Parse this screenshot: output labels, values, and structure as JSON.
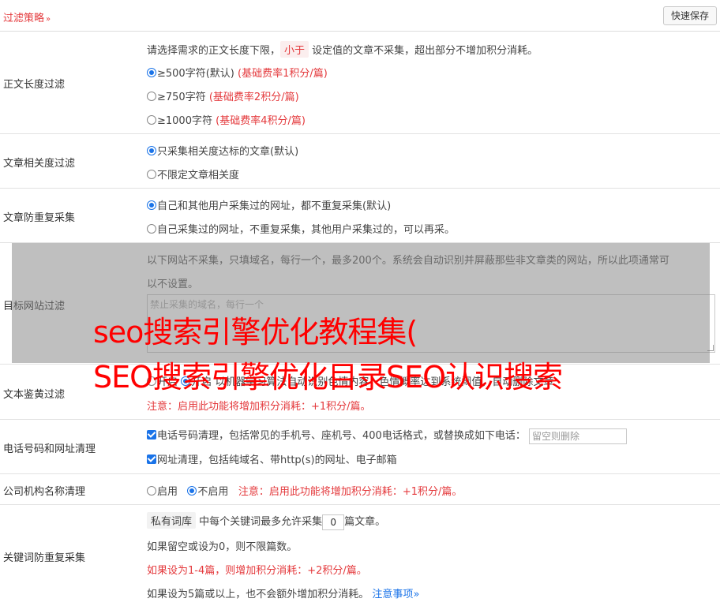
{
  "header": {
    "title": "过滤策略",
    "chevron": "»",
    "quick_save": "快速保存"
  },
  "length_filter": {
    "label": "正文长度过滤",
    "desc_pre": "请选择需求的正文长度下限，",
    "desc_pill": "小于",
    "desc_post": "设定值的文章不采集，超出部分不增加积分消耗。",
    "options": [
      {
        "label": "≥500字符(默认)",
        "note": "(基础费率1积分/篇)",
        "checked": true
      },
      {
        "label": "≥750字符",
        "note": "(基础费率2积分/篇)",
        "checked": false
      },
      {
        "label": "≥1000字符",
        "note": "(基础费率4积分/篇)",
        "checked": false
      }
    ]
  },
  "relevance": {
    "label": "文章相关度过滤",
    "options": [
      {
        "label": "只采集相关度达标的文章(默认)",
        "checked": true
      },
      {
        "label": "不限定文章相关度",
        "checked": false
      }
    ]
  },
  "dedupe": {
    "label": "文章防重复采集",
    "options": [
      {
        "label": "自己和其他用户采集过的网址，都不重复采集(默认)",
        "checked": true
      },
      {
        "label": "自己采集过的网址，不重复采集，其他用户采集过的，可以再采。",
        "checked": false
      }
    ]
  },
  "site_filter": {
    "label": "目标网站过滤",
    "desc_line1": "以下网站不采集，只填域名，每行一个，最多200个。系统会自动识别并屏蔽那些非文章类的网站，所以此项通常可",
    "desc_line2": "以不设置。",
    "placeholder": "禁止采集的域名，每行一个"
  },
  "porn_filter": {
    "label": "文本鉴黄过滤",
    "opt_off": "开启",
    "opt_on": "开启",
    "desc": "以机器学习算法自动识别色情内容，色情概率达到系统阈值，自动删除文章",
    "note": "注意：启用此功能将增加积分消耗：+1积分/篇。"
  },
  "phone_url": {
    "label": "电话号码和网址清理",
    "phone_label": "电话号码清理，包括常见的手机号、座机号、400电话格式，或替换成如下电话：",
    "phone_placeholder": "留空则删除",
    "url_label": "网址清理，包括纯域名、带http(s)的网址、电子邮箱"
  },
  "company": {
    "label": "公司机构名称清理",
    "opt_on": "启用",
    "opt_off": "不启用",
    "note": "注意：启用此功能将增加积分消耗：+1积分/篇。"
  },
  "keyword": {
    "label": "关键词防重复采集",
    "pill": "私有词库",
    "line1_pre": "中每个关键词最多允许采集",
    "line1_value": "0",
    "line1_post": "篇文章。",
    "line2": "如果留空或设为0，则不限篇数。",
    "line3": "如果设为1-4篇，则增加积分消耗：+2积分/篇。",
    "line4": "如果设为5篇或以上，也不会额外增加积分消耗。",
    "link": "注意事项",
    "link_chevron": "»"
  },
  "watermark": {
    "line1": "seo搜索引擎优化教程集(",
    "line2": "SEO搜索引擎优化目录SEO认识搜索"
  },
  "colors": {
    "accent": "#e4393c",
    "link": "#1a73e8",
    "watermark": "#ff0000"
  }
}
